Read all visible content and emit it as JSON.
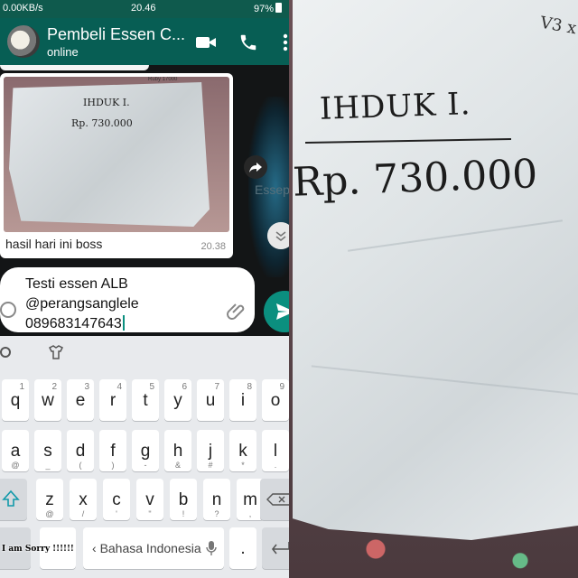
{
  "status_bar": {
    "network_speed": "0.00KB/s",
    "time": "20.46",
    "battery": "97%"
  },
  "app_bar": {
    "title": "Pembeli Essen C...",
    "subtitle": "online"
  },
  "message": {
    "image_heading": "IHDUK I.",
    "image_amount": "Rp. 730.000",
    "image_corner_note": "Ruby 17000",
    "caption": "hasil hari ini boss",
    "time": "20.38"
  },
  "background_text": "Essep.",
  "input": {
    "line1": "Testi essen ALB",
    "line2": "@perangsanglele",
    "line3": "089683147643"
  },
  "keyboard": {
    "row1": [
      {
        "main": "q",
        "sup": "1"
      },
      {
        "main": "w",
        "sup": "2"
      },
      {
        "main": "e",
        "sup": "3"
      },
      {
        "main": "r",
        "sup": "4"
      },
      {
        "main": "t",
        "sup": "5"
      },
      {
        "main": "y",
        "sup": "6"
      },
      {
        "main": "u",
        "sup": "7"
      },
      {
        "main": "i",
        "sup": "8"
      },
      {
        "main": "o",
        "sup": "9"
      }
    ],
    "row2": [
      {
        "main": "a",
        "sub": "@"
      },
      {
        "main": "s",
        "sub": "_"
      },
      {
        "main": "d",
        "sub": "("
      },
      {
        "main": "f",
        "sub": ")"
      },
      {
        "main": "g",
        "sub": "-"
      },
      {
        "main": "h",
        "sub": "&"
      },
      {
        "main": "j",
        "sub": "#"
      },
      {
        "main": "k",
        "sub": "*"
      },
      {
        "main": "l",
        "sub": "."
      }
    ],
    "row3": [
      {
        "main": "z",
        "sub": "@"
      },
      {
        "main": "x",
        "sub": "/"
      },
      {
        "main": "c",
        "sub": "'"
      },
      {
        "main": "v",
        "sub": "\""
      },
      {
        "main": "b",
        "sub": "!"
      },
      {
        "main": "n",
        "sub": "?"
      },
      {
        "main": "m",
        "sub": ","
      }
    ],
    "space_label": "Bahasa Indonesia",
    "period_key": "."
  },
  "watermark": "I am Sorry !!!!!!",
  "photo": {
    "heading": "IHDUK I.",
    "amount": "Rp. 730.000",
    "corner_note": "V3 x"
  },
  "colors": {
    "whatsapp_green": "#075e54",
    "send_button": "#0b8f7f"
  }
}
